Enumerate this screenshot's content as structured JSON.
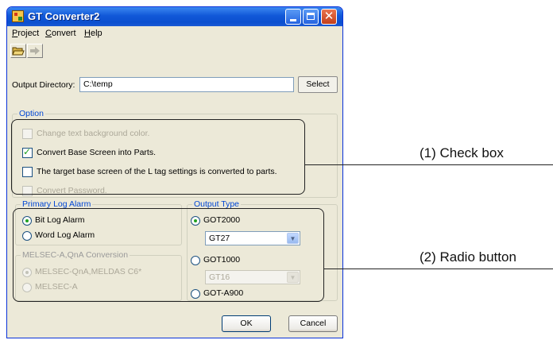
{
  "window": {
    "title": "GT Converter2"
  },
  "menu": [
    {
      "label": "Project",
      "underline": "P",
      "rest": "roject"
    },
    {
      "label": "Convert",
      "underline": "C",
      "rest": "onvert"
    },
    {
      "label": "Help",
      "underline": "H",
      "rest": "elp"
    }
  ],
  "toolbar": {
    "icons": [
      "open-folder-icon",
      "arrow-right-icon"
    ]
  },
  "output": {
    "label": "Output Directory:",
    "value": "C:\\temp",
    "select_label": "Select"
  },
  "option": {
    "legend": "Option",
    "items": [
      {
        "label": "Change text background color.",
        "checked": false,
        "enabled": false
      },
      {
        "label": "Convert Base Screen into Parts.",
        "checked": true,
        "enabled": true
      },
      {
        "label": "The target base screen of the L tag settings is converted to parts.",
        "checked": false,
        "enabled": true
      },
      {
        "label": "Convert Password.",
        "checked": false,
        "enabled": false
      }
    ]
  },
  "primary_log": {
    "legend": "Primary Log Alarm",
    "options": [
      {
        "label": "Bit Log Alarm",
        "selected": true
      },
      {
        "label": "Word Log Alarm",
        "selected": false
      }
    ]
  },
  "melsec": {
    "legend": "MELSEC-A,QnA Conversion",
    "options": [
      {
        "label": "MELSEC-QnA,MELDAS C6*",
        "selected": true,
        "enabled": false
      },
      {
        "label": "MELSEC-A",
        "selected": false,
        "enabled": false
      }
    ]
  },
  "output_type": {
    "legend": "Output Type",
    "got2000": "GOT2000",
    "got2000_model": "GT27",
    "got1000": "GOT1000",
    "got1000_model": "GT16",
    "gota900": "GOT-A900",
    "selected": "GOT2000"
  },
  "buttons": {
    "ok": "OK",
    "cancel": "Cancel"
  },
  "annotations": {
    "checkbox": "(1) Check box",
    "radio": "(2) Radio button"
  }
}
